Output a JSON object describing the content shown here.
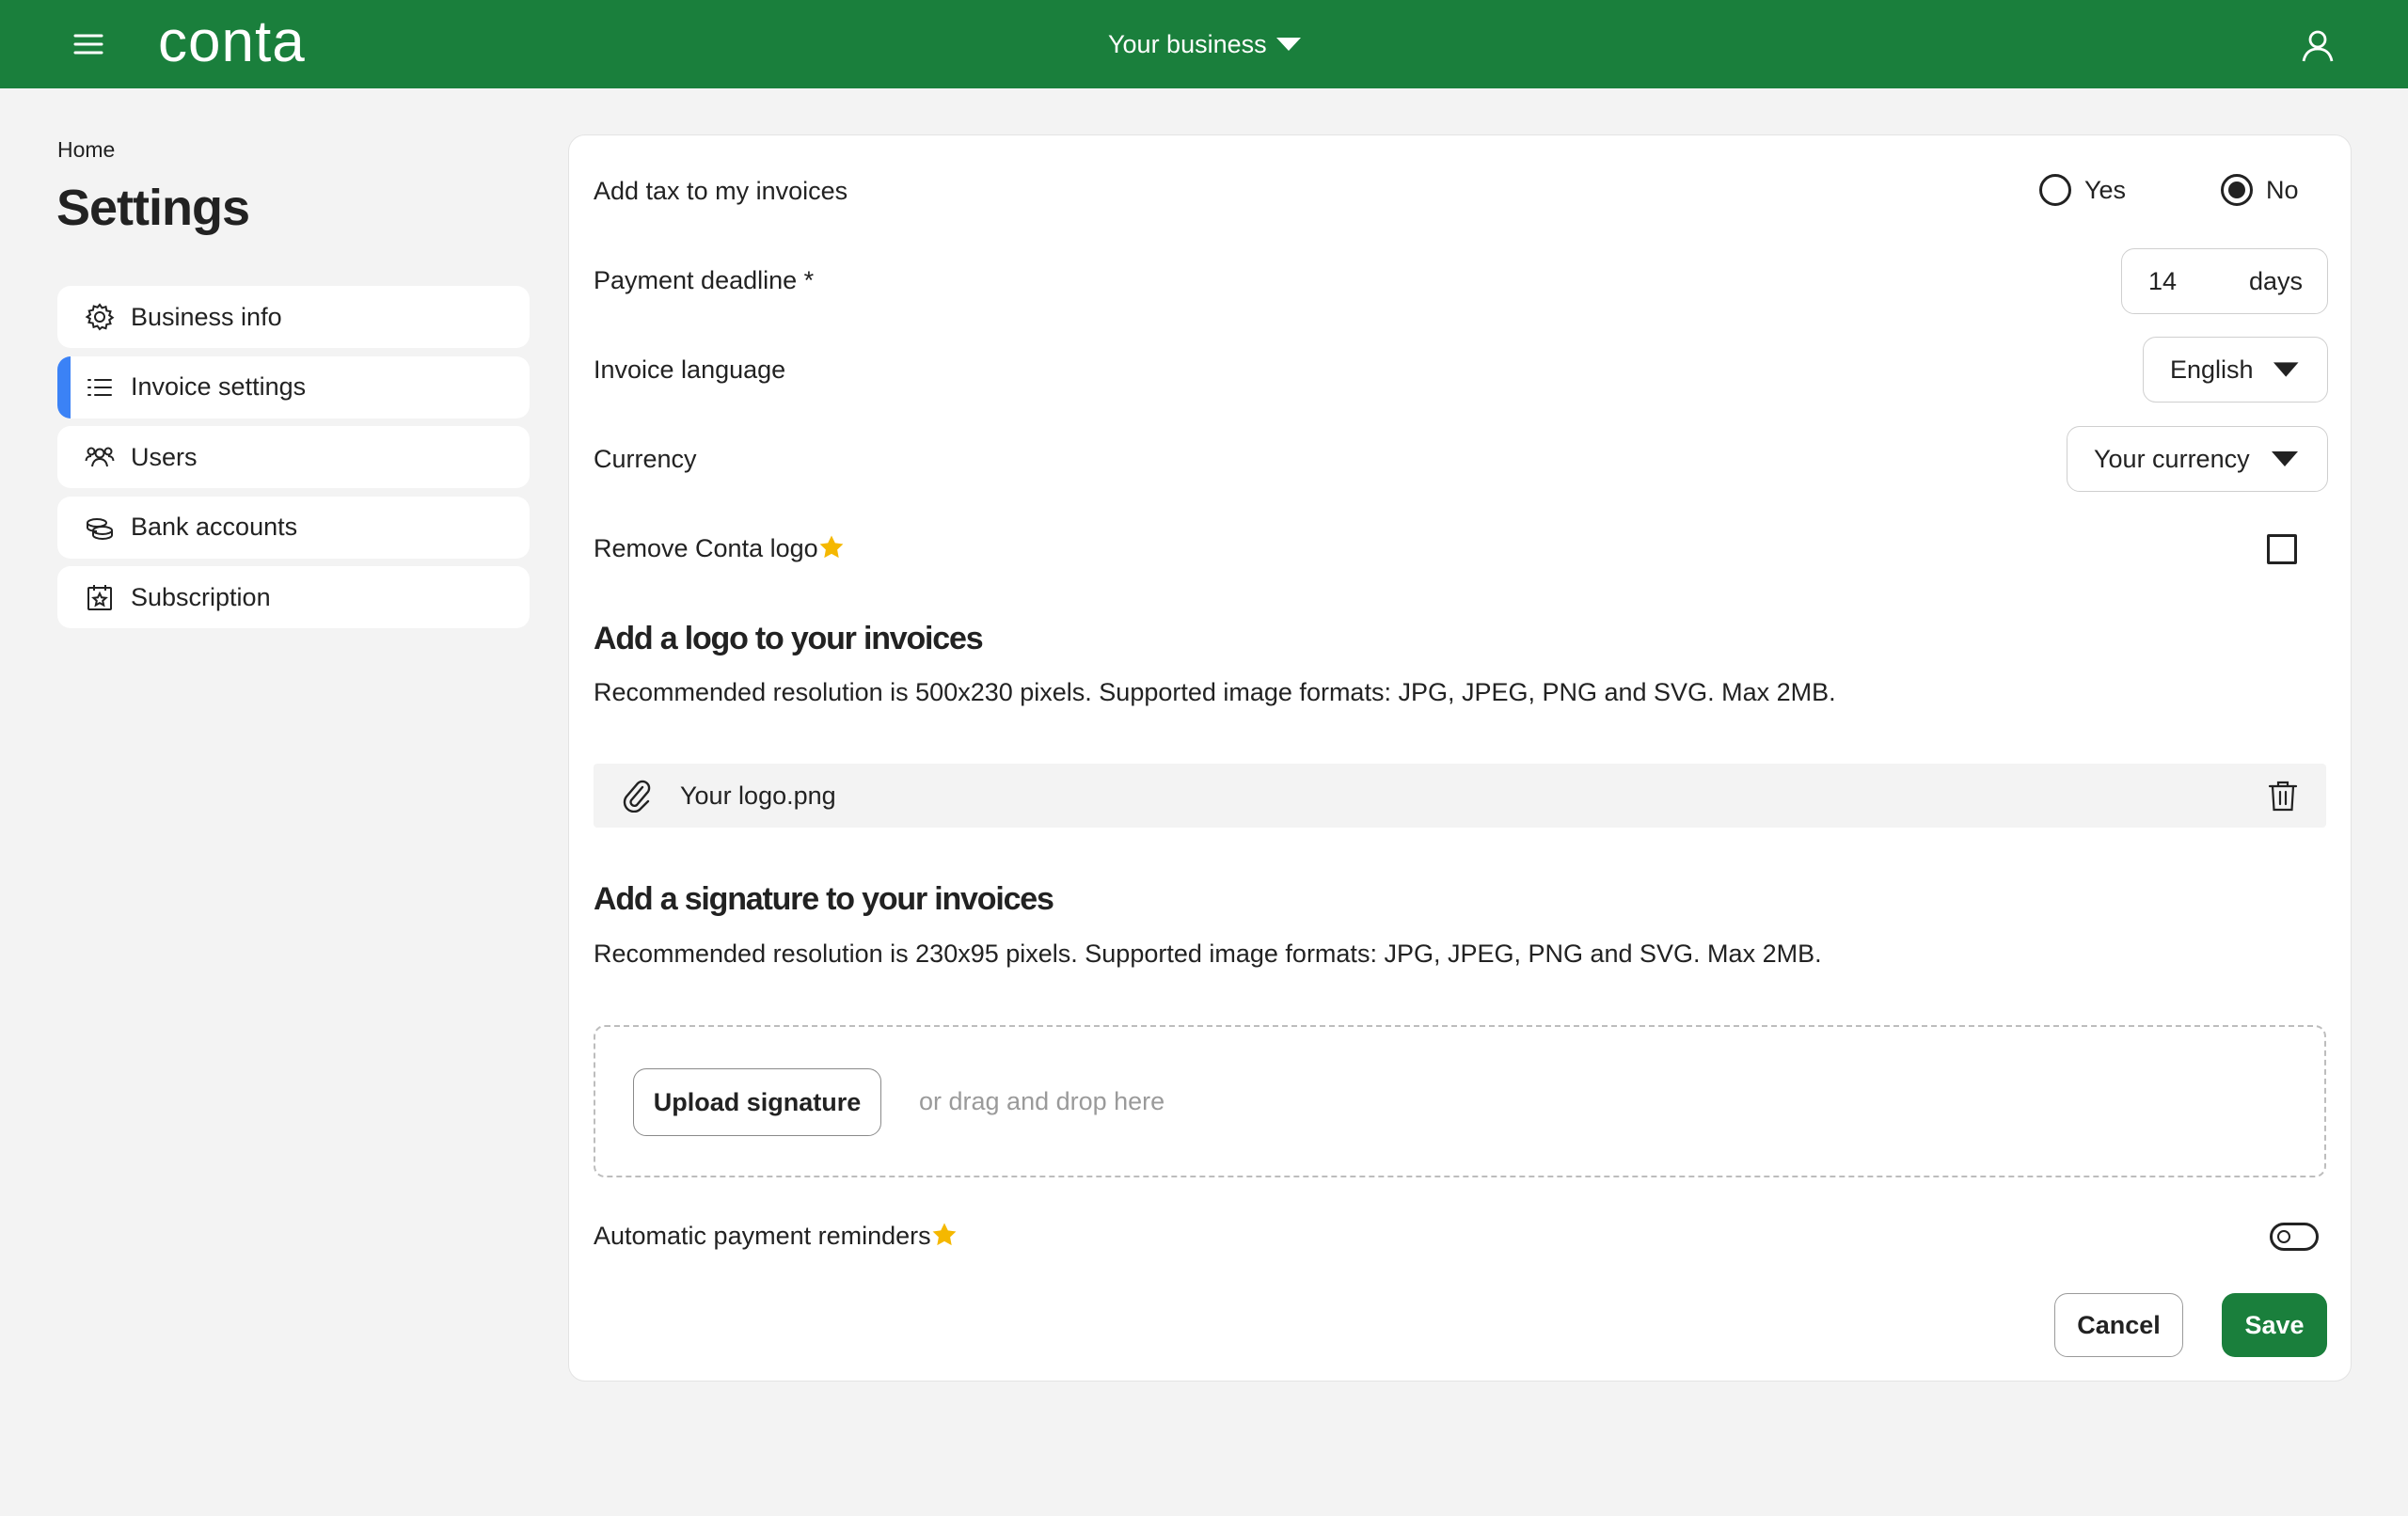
{
  "header": {
    "logo_text": "conta",
    "business_label": "Your business",
    "brand_color": "#1a7f3c",
    "icons": [
      "hamburger-menu-icon",
      "caret-down-icon",
      "user-icon"
    ]
  },
  "breadcrumb": "Home",
  "page_title": "Settings",
  "sidebar": {
    "active_color": "#3b82f6",
    "items": [
      {
        "label": "Business info",
        "icon": "gear-icon",
        "active": false
      },
      {
        "label": "Invoice settings",
        "icon": "list-icon",
        "active": true
      },
      {
        "label": "Users",
        "icon": "users-icon",
        "active": false
      },
      {
        "label": "Bank accounts",
        "icon": "coins-icon",
        "active": false
      },
      {
        "label": "Subscription",
        "icon": "calendar-star-icon",
        "active": false
      }
    ]
  },
  "form": {
    "tax": {
      "label": "Add tax to my invoices",
      "yes_label": "Yes",
      "no_label": "No",
      "selected": "No"
    },
    "payment_deadline": {
      "label": "Payment deadline *",
      "value": "14",
      "unit": "days"
    },
    "invoice_language": {
      "label": "Invoice language",
      "value": "English"
    },
    "currency": {
      "label": "Currency",
      "value": "Your currency"
    },
    "remove_logo": {
      "label": "Remove Conta logo",
      "checked": false,
      "premium_star_color": "#f5b800"
    },
    "logo_section": {
      "title": "Add a logo to your invoices",
      "description": "Recommended resolution is 500x230 pixels. Supported image formats: JPG, JPEG, PNG and SVG. Max 2MB.",
      "file_name": "Your logo.png"
    },
    "signature_section": {
      "title": "Add a signature to your invoices",
      "description": "Recommended resolution is 230x95 pixels. Supported image formats: JPG, JPEG, PNG and SVG. Max 2MB.",
      "upload_label": "Upload signature",
      "drop_hint": "or drag and drop here"
    },
    "reminders": {
      "label": "Automatic payment reminders",
      "enabled": false
    },
    "cancel_label": "Cancel",
    "save_label": "Save"
  }
}
